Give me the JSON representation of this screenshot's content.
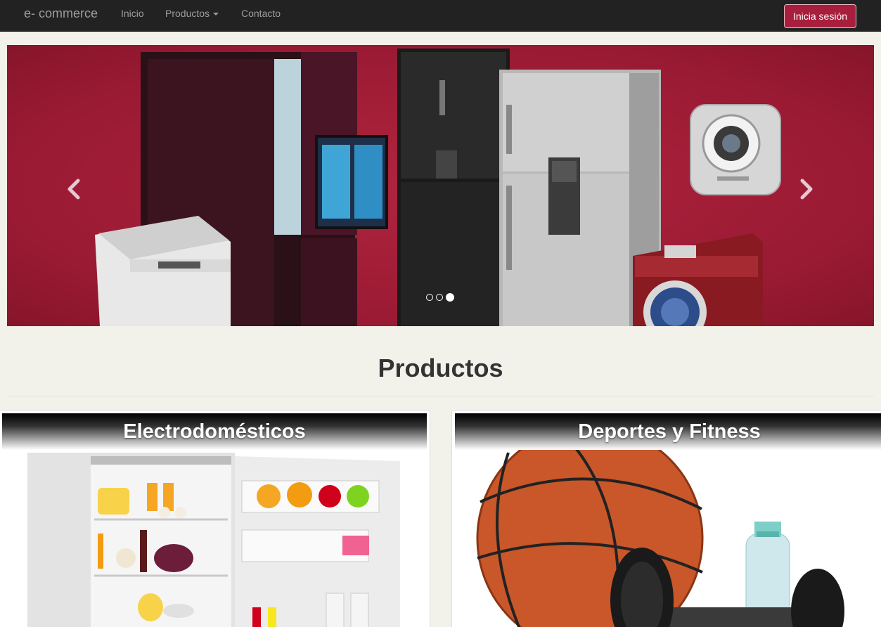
{
  "navbar": {
    "brand": "e- commerce",
    "links": [
      {
        "label": "Inicio"
      },
      {
        "label": "Productos"
      },
      {
        "label": "Contacto"
      }
    ],
    "login_label": "Inicia sesión"
  },
  "carousel": {
    "slide_count": 3,
    "active_index": 2,
    "prev_icon": "chevron-left-icon",
    "next_icon": "chevron-right-icon"
  },
  "section": {
    "title": "Productos"
  },
  "categories": [
    {
      "title": "Electrodomésticos"
    },
    {
      "title": "Deportes y Fitness"
    }
  ],
  "colors": {
    "navbar_bg": "#222222",
    "accent": "#a81e3d",
    "carousel_bg": "#9a1a33",
    "page_bg": "#f2f1ea"
  }
}
